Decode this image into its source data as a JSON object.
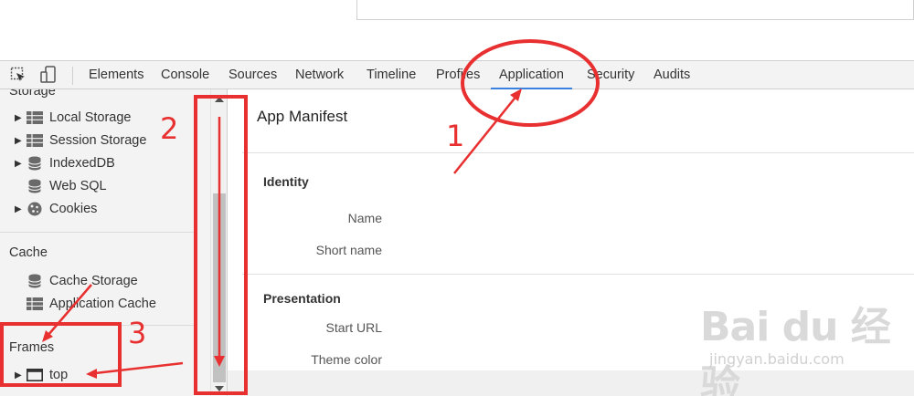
{
  "tabs": [
    "Elements",
    "Console",
    "Sources",
    "Network",
    "Timeline",
    "Profiles",
    "Application",
    "Security",
    "Audits"
  ],
  "active_tab": "Application",
  "sidebar": {
    "storage_header": "Storage",
    "storage_items": [
      {
        "label": "Local Storage",
        "icon": "grid-icon",
        "expandable": true
      },
      {
        "label": "Session Storage",
        "icon": "grid-icon",
        "expandable": true
      },
      {
        "label": "IndexedDB",
        "icon": "database-icon",
        "expandable": true
      },
      {
        "label": "Web SQL",
        "icon": "database-icon",
        "expandable": false
      },
      {
        "label": "Cookies",
        "icon": "cookie-icon",
        "expandable": true
      }
    ],
    "cache_header": "Cache",
    "cache_items": [
      {
        "label": "Cache Storage",
        "icon": "database-icon",
        "expandable": false
      },
      {
        "label": "Application Cache",
        "icon": "grid-icon",
        "expandable": false
      }
    ],
    "frames_header": "Frames",
    "frames_items": [
      {
        "label": "top",
        "icon": "frame-icon",
        "expandable": true
      }
    ]
  },
  "main": {
    "title": "App Manifest",
    "identity_title": "Identity",
    "identity_fields": [
      "Name",
      "Short name"
    ],
    "presentation_title": "Presentation",
    "presentation_fields": [
      "Start URL",
      "Theme color"
    ]
  },
  "annotations": {
    "labels": [
      "1",
      "2",
      "3"
    ],
    "color": "#e83030"
  },
  "watermark": {
    "brand": "Bai  du 经验",
    "url": "jingyan.baidu.com"
  },
  "colors": {
    "active_tab_underline": "#3b82e0",
    "panel_bg": "#f3f3f3"
  }
}
